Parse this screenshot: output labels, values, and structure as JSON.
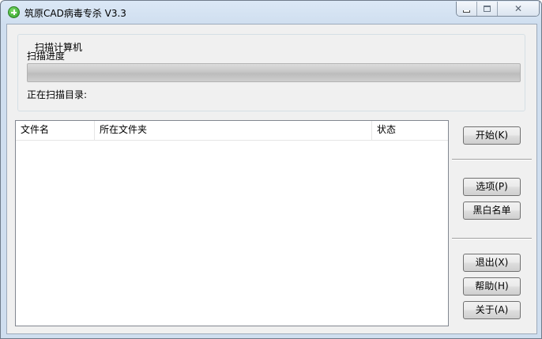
{
  "window": {
    "title": "筑原CAD病毒专杀  V3.3",
    "controls": {
      "minimize_icon": "minimize-icon",
      "maximize_icon": "maximize-icon",
      "close_icon": "close-icon",
      "close_glyph": "✕"
    }
  },
  "scan_group": {
    "title": "扫描计算机",
    "progress_label": "扫描进度",
    "progress_value": 0,
    "current_dir_label": "正在扫描目录:"
  },
  "file_list": {
    "columns": [
      "文件名",
      "所在文件夹",
      "状态"
    ],
    "rows": []
  },
  "buttons": {
    "start": "开始(K)",
    "options": "选项(P)",
    "blacklist": "黑白名单",
    "exit": "退出(X)",
    "help": "帮助(H)",
    "about": "关于(A)"
  },
  "colors": {
    "progress_fill": "#0aa000",
    "title_bar": "#dbe8f6"
  }
}
